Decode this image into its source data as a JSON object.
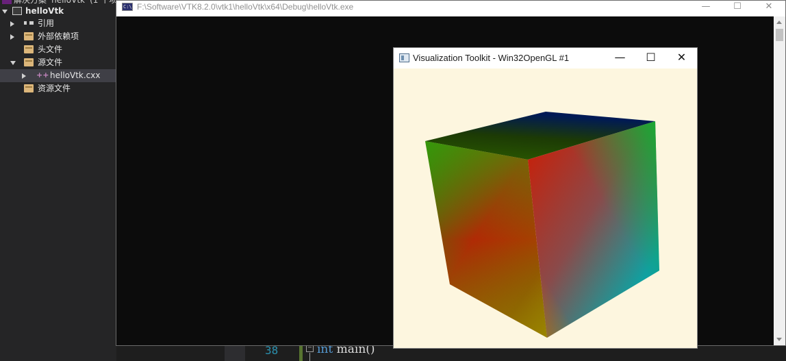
{
  "solution_explorer": {
    "partial_top_label": "解决方案 'helloVtk' (1 个项目",
    "project": "helloVtk",
    "items": [
      {
        "label": "引用"
      },
      {
        "label": "外部依赖项"
      },
      {
        "label": "头文件"
      },
      {
        "label": "源文件"
      },
      {
        "label": "helloVtk.cxx"
      },
      {
        "label": "资源文件"
      }
    ]
  },
  "editor": {
    "line_number": "38",
    "code_keyword": "int",
    "code_rest": " main()",
    "fold_symbol": "−"
  },
  "console": {
    "title": "F:\\Software\\VTK8.2.0\\vtk1\\helloVtk\\x64\\Debug\\helloVtk.exe",
    "icon_text": "C:\\",
    "minimize": "—",
    "maximize": "☐",
    "close": "✕"
  },
  "vtk_window": {
    "title": "Visualization Toolkit - Win32OpenGL #1",
    "minimize": "—",
    "maximize": "☐",
    "close": "✕",
    "background_color": "#fdf6df"
  }
}
